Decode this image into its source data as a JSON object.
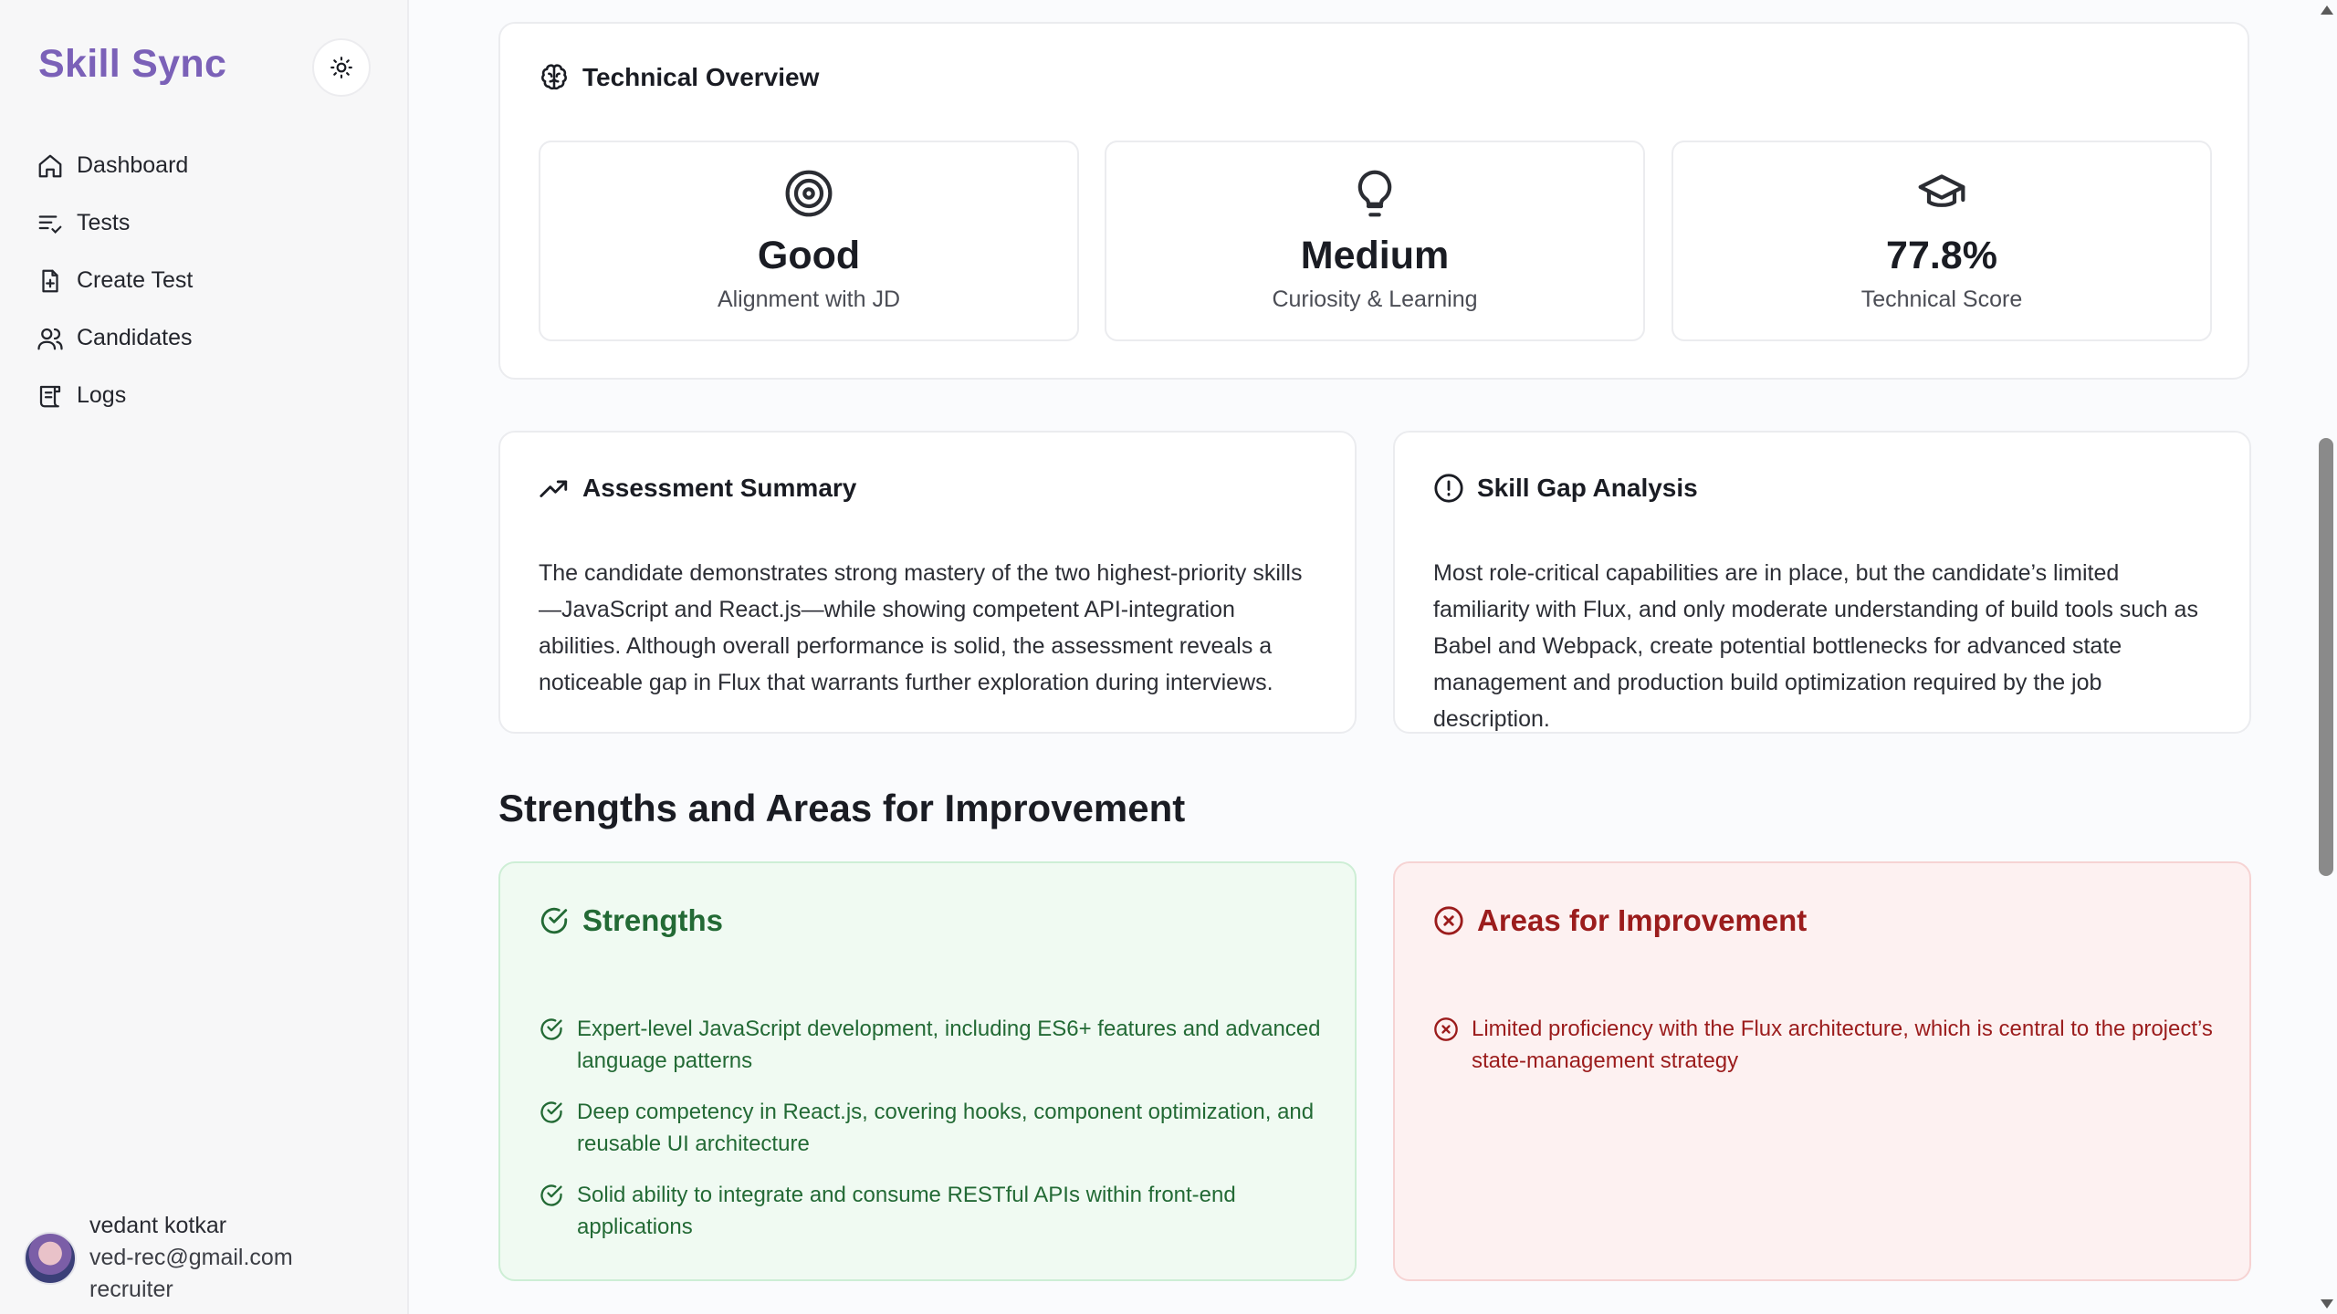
{
  "app": {
    "brand": "Skill Sync"
  },
  "sidebar": {
    "items": [
      {
        "label": "Dashboard",
        "icon": "home-icon"
      },
      {
        "label": "Tests",
        "icon": "list-check-icon"
      },
      {
        "label": "Create Test",
        "icon": "file-plus-icon"
      },
      {
        "label": "Candidates",
        "icon": "users-icon"
      },
      {
        "label": "Logs",
        "icon": "scroll-icon"
      }
    ],
    "user": {
      "name": "vedant kotkar",
      "email": "ved-rec@gmail.com",
      "role": "recruiter"
    }
  },
  "overview": {
    "title": "Technical Overview",
    "metrics": [
      {
        "value": "Good",
        "label": "Alignment with JD",
        "icon": "target-icon"
      },
      {
        "value": "Medium",
        "label": "Curiosity & Learning",
        "icon": "lightbulb-icon"
      },
      {
        "value": "77.8%",
        "label": "Technical Score",
        "icon": "graduation-cap-icon"
      }
    ]
  },
  "summary": {
    "title": "Assessment Summary",
    "text": "The candidate demonstrates strong mastery of the two highest-priority skills—JavaScript and React.js—while showing competent API-integration abilities. Although overall performance is solid, the assessment reveals a noticeable gap in Flux that warrants further exploration during interviews."
  },
  "gap": {
    "title": "Skill Gap Analysis",
    "text": "Most role-critical capabilities are in place, but the candidate’s limited familiarity with Flux, and only moderate understanding of build tools such as Babel and Webpack, create potential bottlenecks for advanced state management and production build optimization required by the job description."
  },
  "section": {
    "heading": "Strengths and Areas for Improvement"
  },
  "strengths": {
    "title": "Strengths",
    "items": [
      "Expert-level JavaScript development, including ES6+ features and advanced language patterns",
      "Deep competency in React.js, covering hooks, component optimization, and reusable UI architecture",
      "Solid ability to integrate and consume RESTful APIs within front-end applications"
    ]
  },
  "improvements": {
    "title": "Areas for Improvement",
    "items": [
      "Limited proficiency with the Flux architecture, which is central to the project’s state-management strategy"
    ]
  },
  "colors": {
    "brand": "#7b61b8",
    "strength": "#236a35",
    "improve": "#9b1c1c"
  }
}
